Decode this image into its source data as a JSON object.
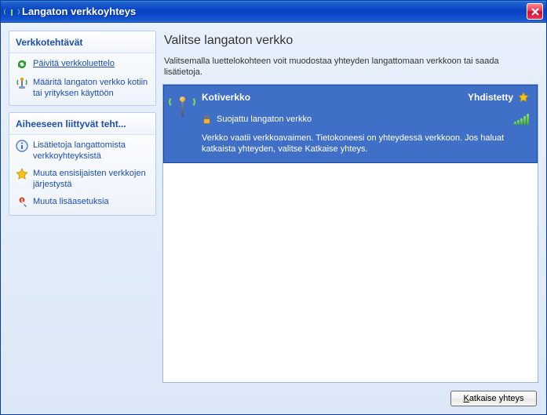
{
  "window": {
    "title": "Langaton verkkoyhteys"
  },
  "sidebar": {
    "tasks_header": "Verkkotehtävät",
    "refresh_label": "Päivitä verkkoluettelo",
    "setup_label": "Määritä langaton verkko kotiin tai yrityksen käyttöön",
    "related_header": "Aiheeseen liittyvät teht...",
    "info_label": "Lisätietoja langattomista verkkoyhteyksistä",
    "reorder_label": "Muuta ensisijaisten verkkojen järjestystä",
    "advanced_label": "Muuta lisäasetuksia"
  },
  "main": {
    "title": "Valitse langaton verkko",
    "subtitle": "Valitsemalla luettelokohteen voit muodostaa yhteyden langattomaan verkkoon tai saada lisätietoja."
  },
  "network": {
    "name": "Kotiverkko",
    "status": "Yhdistetty",
    "security": "Suojattu langaton verkko",
    "description": "Verkko vaatii verkkoavaimen. Tietokoneesi on yhteydessä verkkoon. Jos haluat katkaista yhteyden, valitse Katkaise yhteys.",
    "signal_bars": 5,
    "favorite": true,
    "selected": true
  },
  "buttons": {
    "disconnect_prefix": "K",
    "disconnect_rest": "atkaise yhteys"
  },
  "colors": {
    "titlebar": "#0a43c6",
    "panel_header": "#1c4fb0",
    "selection": "#3f6fc7",
    "signal": "#3db020"
  }
}
